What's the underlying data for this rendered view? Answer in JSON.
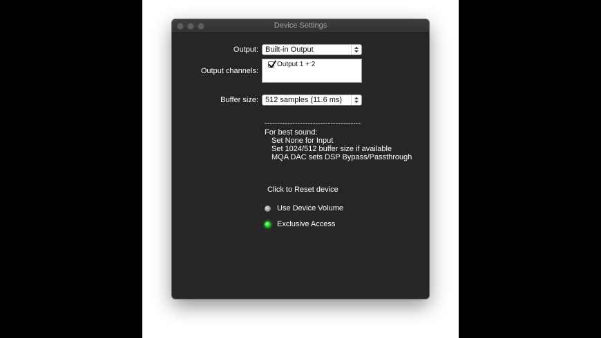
{
  "window": {
    "title": "Device Settings"
  },
  "output": {
    "label": "Output:",
    "value": "Built-in Output"
  },
  "channels": {
    "label": "Output channels:",
    "items": [
      {
        "label": "Output 1 + 2",
        "checked": true
      }
    ]
  },
  "buffer": {
    "label": "Buffer size:",
    "value": "512 samples (11.6 ms)"
  },
  "info": {
    "separator": "--------------------------------------",
    "heading": "For best sound:",
    "lines": [
      "Set None for Input",
      "Set 1024/512 buffer size if available",
      "MQA DAC sets DSP Bypass/Passthrough"
    ]
  },
  "reset": {
    "label": "Click to Reset device"
  },
  "options": [
    {
      "label": "Use Device Volume",
      "on": false
    },
    {
      "label": "Exclusive Access",
      "on": true
    }
  ],
  "colors": {
    "window_bg": "#262626",
    "active_green": "#21d421"
  }
}
